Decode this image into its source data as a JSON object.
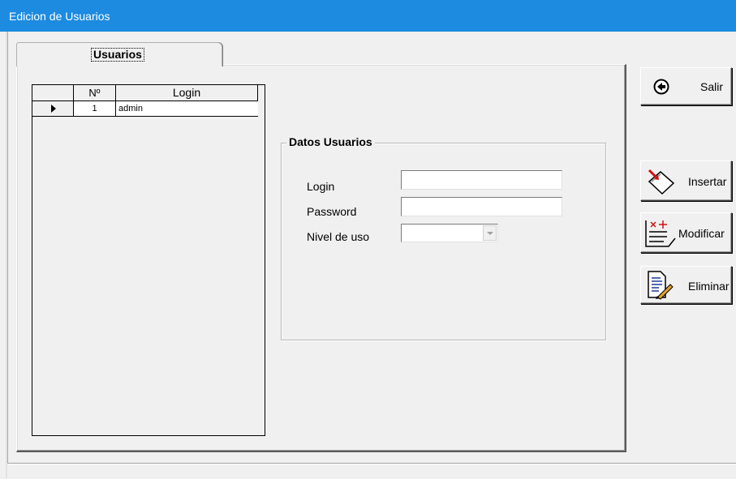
{
  "window": {
    "title": "Edicion de Usuarios"
  },
  "tabs": [
    {
      "label": "Usuarios",
      "active": true
    }
  ],
  "grid": {
    "columns": [
      "",
      "Nº",
      "Login"
    ],
    "rows": [
      {
        "selected": true,
        "num": "1",
        "login": "admin"
      }
    ]
  },
  "form": {
    "group_title": "Datos Usuarios",
    "login_label": "Login",
    "password_label": "Password",
    "level_label": "Nivel de uso",
    "login_value": "",
    "password_value": "",
    "level_value": ""
  },
  "buttons": {
    "exit": "Salir",
    "insert": "Insertar",
    "modify": "Modificar",
    "delete": "Eliminar"
  },
  "colors": {
    "titlebar": "#1c8be0",
    "background": "#f0f0f0"
  }
}
